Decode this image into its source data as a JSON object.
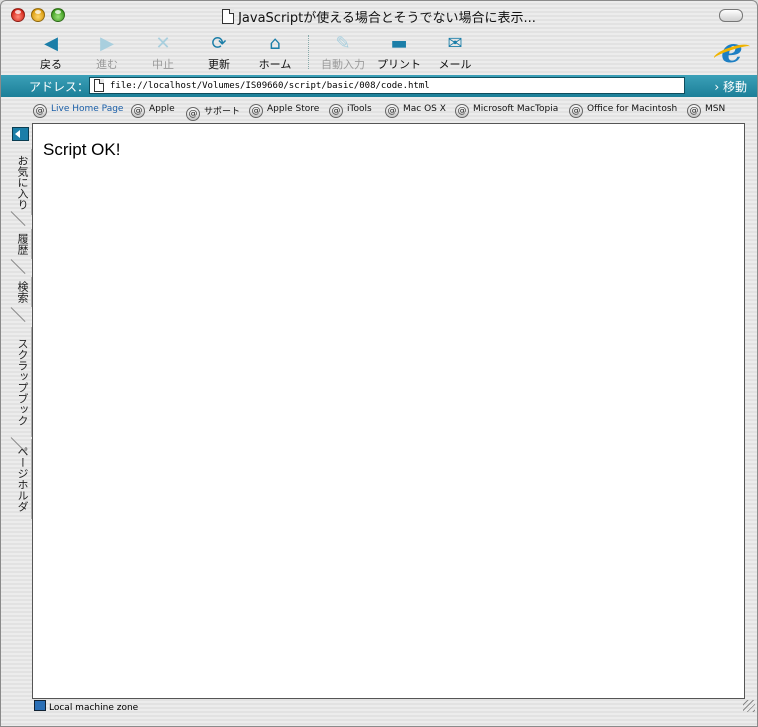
{
  "window": {
    "title": "JavaScriptが使える場合とそうでない場合に表示..."
  },
  "toolbar": {
    "back_label": "戻る",
    "forward_label": "進む",
    "stop_label": "中止",
    "refresh_label": "更新",
    "home_label": "ホーム",
    "autofill_label": "自動入力",
    "print_label": "プリント",
    "mail_label": "メール"
  },
  "address": {
    "label": "アドレス：",
    "url": "file://localhost/Volumes/IS09660/script/basic/008/code.html",
    "go_label": "移動"
  },
  "favorites": [
    {
      "label": "Live Home Page"
    },
    {
      "label": "Apple"
    },
    {
      "label": "サポート"
    },
    {
      "label": "Apple Store"
    },
    {
      "label": "iTools"
    },
    {
      "label": "Mac OS X"
    },
    {
      "label": "Microsoft MacTopia"
    },
    {
      "label": "Office for Macintosh"
    },
    {
      "label": "MSN"
    }
  ],
  "sidebar": {
    "tabs": [
      {
        "label": "お気に入り"
      },
      {
        "label": "履歴"
      },
      {
        "label": "検索"
      },
      {
        "label": "スクラップブック"
      },
      {
        "label": "ページホルダ"
      }
    ]
  },
  "page": {
    "body_text": "Script OK!"
  },
  "status": {
    "zone": "Local machine zone"
  },
  "colors": {
    "accent": "#1b7ea8",
    "address_bar": "#2a8fa8"
  }
}
